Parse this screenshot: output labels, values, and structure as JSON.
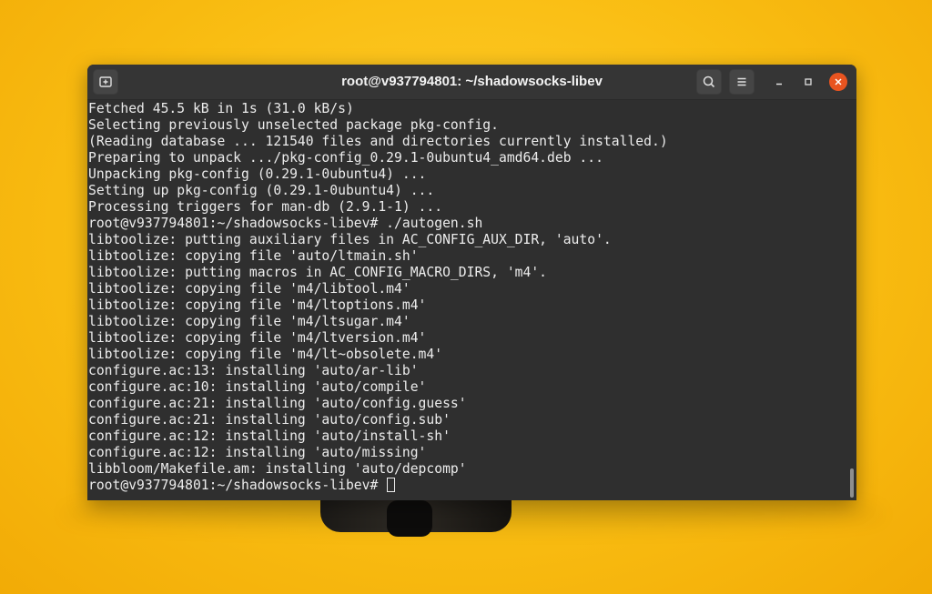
{
  "window": {
    "title": "root@v937794801: ~/shadowsocks-libev"
  },
  "titlebar": {
    "new_tab_icon": "new-tab-icon",
    "search_icon": "search-icon",
    "menu_icon": "hamburger-menu-icon",
    "minimize_icon": "minimize-icon",
    "maximize_icon": "maximize-icon",
    "close_icon": "close-icon"
  },
  "colors": {
    "accent_close": "#e95420",
    "terminal_bg": "#2f2f2f",
    "terminal_fg": "#ececec",
    "wallpaper": "#f9bd12"
  },
  "terminal": {
    "lines": [
      "Fetched 45.5 kB in 1s (31.0 kB/s)",
      "Selecting previously unselected package pkg-config.",
      "(Reading database ... 121540 files and directories currently installed.)",
      "Preparing to unpack .../pkg-config_0.29.1-0ubuntu4_amd64.deb ...",
      "Unpacking pkg-config (0.29.1-0ubuntu4) ...",
      "Setting up pkg-config (0.29.1-0ubuntu4) ...",
      "Processing triggers for man-db (2.9.1-1) ...",
      "root@v937794801:~/shadowsocks-libev# ./autogen.sh",
      "libtoolize: putting auxiliary files in AC_CONFIG_AUX_DIR, 'auto'.",
      "libtoolize: copying file 'auto/ltmain.sh'",
      "libtoolize: putting macros in AC_CONFIG_MACRO_DIRS, 'm4'.",
      "libtoolize: copying file 'm4/libtool.m4'",
      "libtoolize: copying file 'm4/ltoptions.m4'",
      "libtoolize: copying file 'm4/ltsugar.m4'",
      "libtoolize: copying file 'm4/ltversion.m4'",
      "libtoolize: copying file 'm4/lt~obsolete.m4'",
      "configure.ac:13: installing 'auto/ar-lib'",
      "configure.ac:10: installing 'auto/compile'",
      "configure.ac:21: installing 'auto/config.guess'",
      "configure.ac:21: installing 'auto/config.sub'",
      "configure.ac:12: installing 'auto/install-sh'",
      "configure.ac:12: installing 'auto/missing'",
      "libbloom/Makefile.am: installing 'auto/depcomp'"
    ],
    "prompt": "root@v937794801:~/shadowsocks-libev# "
  }
}
